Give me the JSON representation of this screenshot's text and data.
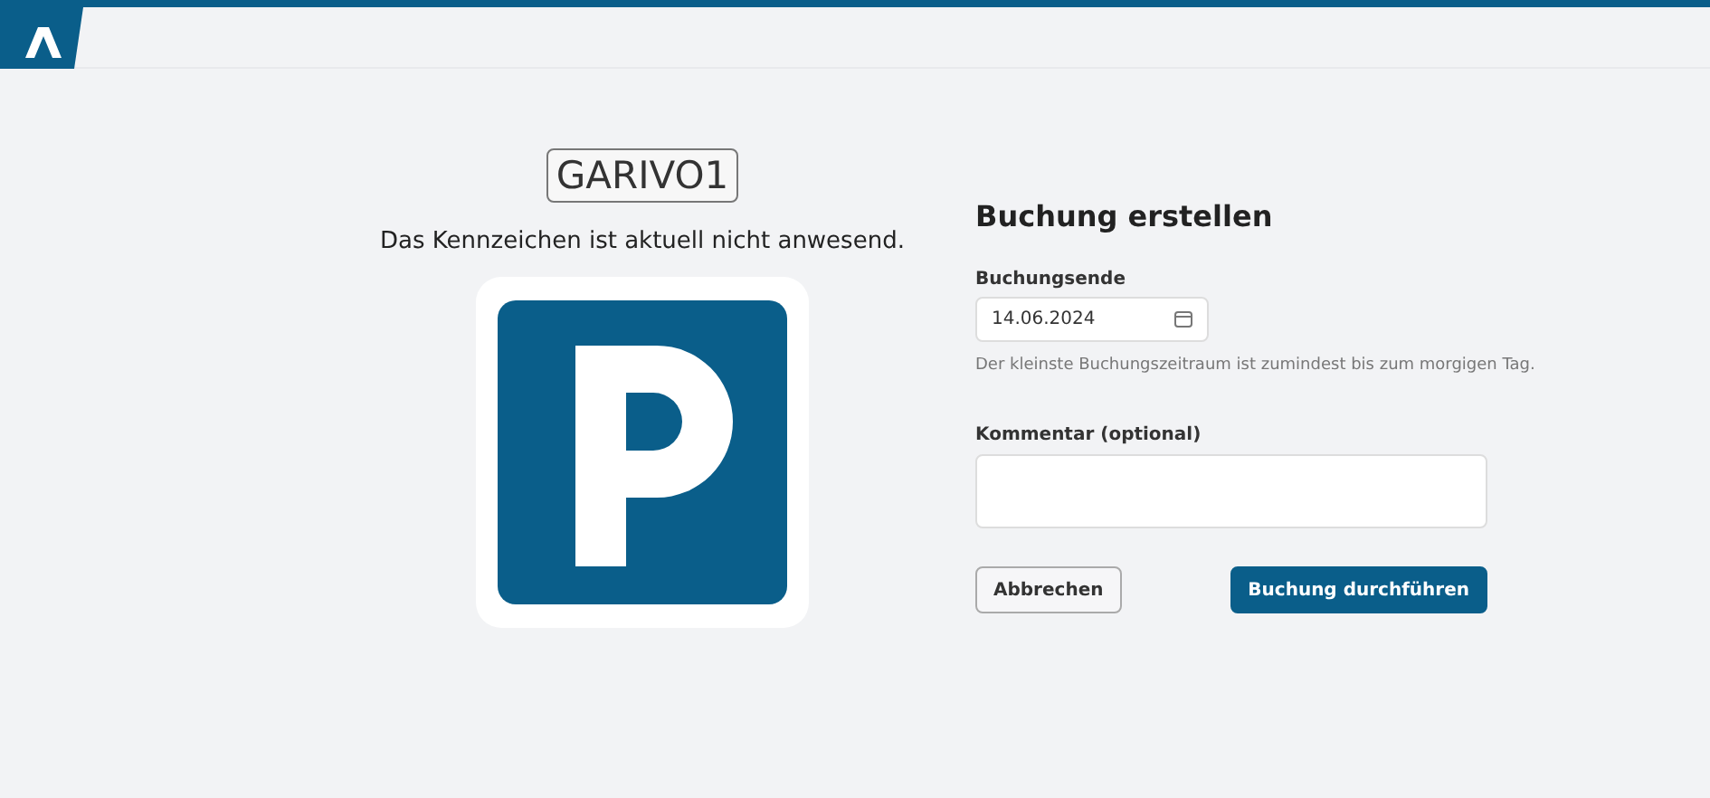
{
  "vehicle": {
    "plate": "GARIVO1",
    "status": "Das Kennzeichen ist aktuell nicht anwesend."
  },
  "form": {
    "title": "Buchung erstellen",
    "end_field": {
      "label": "Buchungsende",
      "value": "14.06.2024",
      "hint": "Der kleinste Buchungszeitraum ist zumindest bis zum morgigen Tag."
    },
    "comment_field": {
      "label": "Kommentar (optional)"
    },
    "buttons": [
      {
        "kind": "secondary",
        "label": "Abbrechen"
      },
      {
        "kind": "primary",
        "label": "Buchung durchführen"
      }
    ]
  }
}
